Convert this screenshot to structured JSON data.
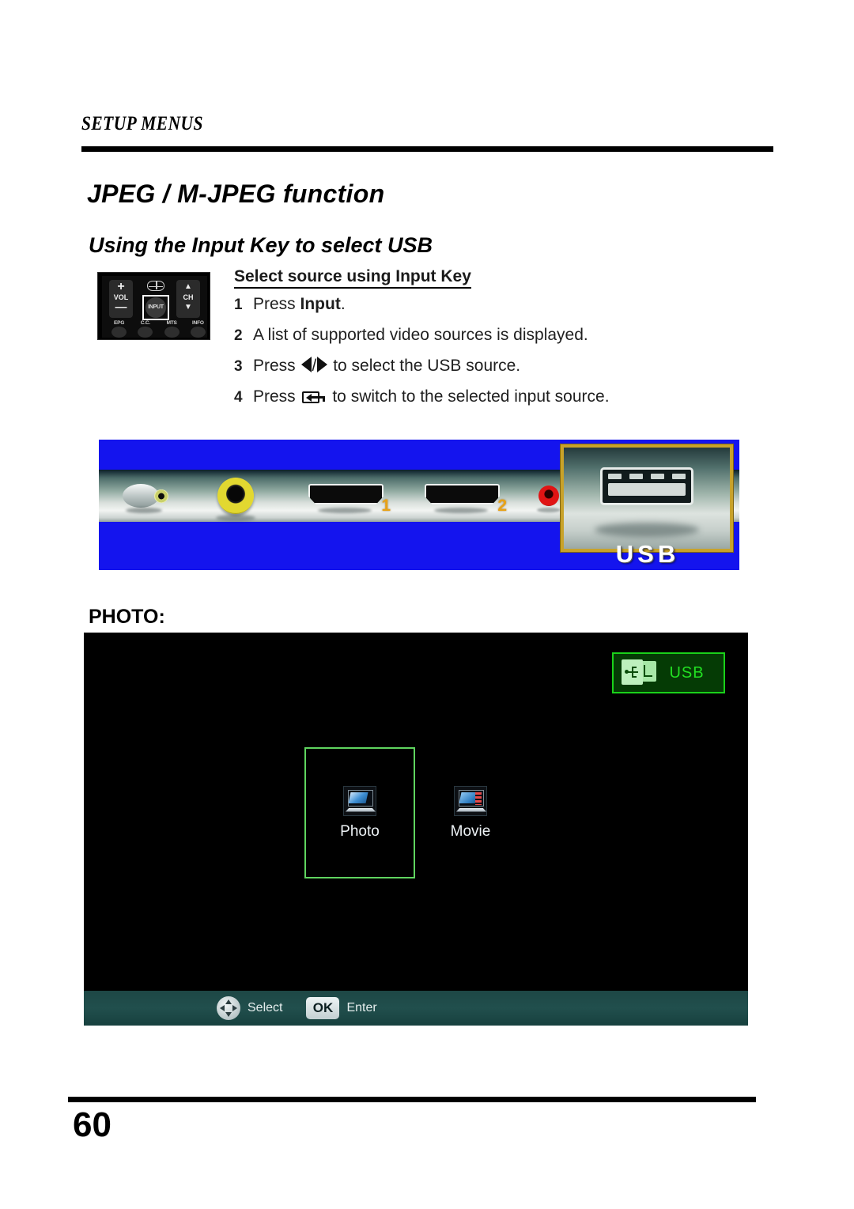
{
  "page": {
    "running_head": "SETUP MENUS",
    "title": "JPEG / M-JPEG  function",
    "subtitle": "Using the Input Key to select USB",
    "page_number": "60"
  },
  "remote_keypad": {
    "vol_label": "VOL",
    "vol_plus": "+",
    "vol_minus": "—",
    "ch_label": "CH",
    "ch_up": "▲",
    "ch_down": "▼",
    "input_label": "INPUT",
    "bottom_buttons": [
      "EPG",
      "C.C.",
      "MTS",
      "INFO"
    ]
  },
  "instructions": {
    "heading": "Select source using Input Key",
    "steps": [
      {
        "num": "1",
        "prefix": "Press ",
        "bold": "Input",
        "suffix": "."
      },
      {
        "num": "2",
        "text": "A list of supported video sources is displayed."
      },
      {
        "num": "3",
        "prefix": "Press ",
        "suffix": " to select the USB source.",
        "separator": "/"
      },
      {
        "num": "4",
        "prefix": "Press ",
        "suffix": " to switch to the selected input source."
      }
    ]
  },
  "input_source_image": {
    "usb_caption": "USB",
    "hdmi_1_number": "1",
    "hdmi_2_number": "2",
    "background_color": "#1414ee",
    "highlight_color": "#c8a22a"
  },
  "photo_section": {
    "label": "PHOTO:",
    "usb_badge": {
      "text": "USB",
      "border_color": "#1ad11a",
      "fill_color": "#053b05",
      "text_color": "#22e022"
    },
    "media_items": [
      {
        "label": "Photo",
        "selected": true
      },
      {
        "label": "Movie",
        "selected": false
      }
    ],
    "status_bar": {
      "select_label": "Select",
      "ok_label": "OK",
      "enter_label": "Enter",
      "background_color": "#1d4745"
    }
  }
}
